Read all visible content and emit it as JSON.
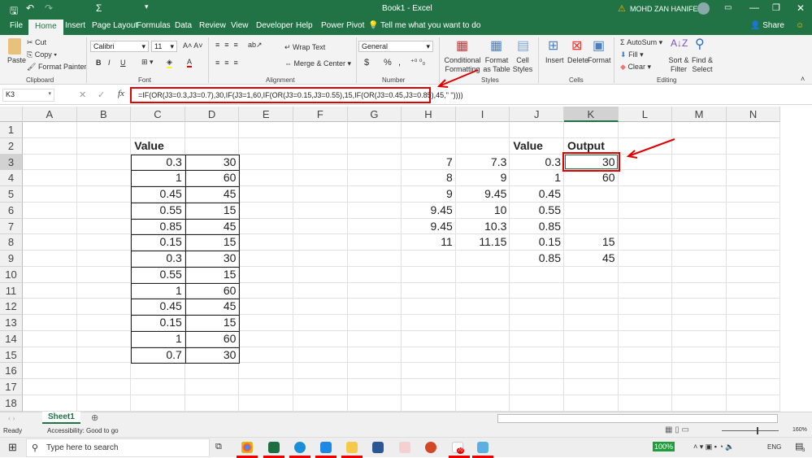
{
  "title": {
    "doc": "Book1 - Excel",
    "user": "MOHD ZAN HANIFEE"
  },
  "tabs": [
    "File",
    "Home",
    "Insert",
    "Page Layout",
    "Formulas",
    "Data",
    "Review",
    "View",
    "Developer",
    "Help",
    "Power Pivot"
  ],
  "tell_me": "Tell me what you want to do",
  "share": "Share",
  "ribbon": {
    "paste": "Paste",
    "cut": "Cut",
    "copy": "Copy",
    "format_painter": "Format Painter",
    "clipboard": "Clipboard",
    "font_name": "Calibri",
    "font_size": "11",
    "font": "Font",
    "bold": "B",
    "italic": "I",
    "underline": "U",
    "wrap_text": "Wrap Text",
    "merge_center": "Merge & Center",
    "alignment": "Alignment",
    "number_format": "General",
    "currency": "$",
    "percent": "%",
    "comma": ",",
    "number": "Number",
    "conditional_formatting": "Conditional Formatting",
    "format_as_table": "Format as Table",
    "cell_styles": "Cell Styles",
    "styles": "Styles",
    "insert": "Insert",
    "delete": "Delete",
    "format": "Format",
    "cells": "Cells",
    "autosum": "AutoSum",
    "fill": "Fill",
    "clear": "Clear",
    "sort_filter": "Sort & Filter",
    "find_select": "Find & Select",
    "editing": "Editing"
  },
  "formula_bar": {
    "name_box": "K3",
    "fx": "fx",
    "formula": "=IF(OR(J3=0.3,J3=0.7),30,IF(J3=1,60,IF(OR(J3=0.15,J3=0.55),15,IF(OR(J3=0.45,J3=0.85),45,\" \"))))"
  },
  "columns": [
    "A",
    "B",
    "C",
    "D",
    "E",
    "F",
    "G",
    "H",
    "I",
    "J",
    "K",
    "L",
    "M",
    "N"
  ],
  "rows": [
    "1",
    "2",
    "3",
    "4",
    "5",
    "6",
    "7",
    "8",
    "9",
    "10",
    "11",
    "12",
    "13",
    "14",
    "15",
    "16",
    "17",
    "18"
  ],
  "cells": [
    {
      "c": 2,
      "r": 2,
      "v": "Value",
      "b": true
    },
    {
      "c": 2,
      "r": 3,
      "v": "0.3"
    },
    {
      "c": 3,
      "r": 3,
      "v": "30"
    },
    {
      "c": 2,
      "r": 4,
      "v": "1"
    },
    {
      "c": 3,
      "r": 4,
      "v": "60"
    },
    {
      "c": 2,
      "r": 5,
      "v": "0.45"
    },
    {
      "c": 3,
      "r": 5,
      "v": "45"
    },
    {
      "c": 2,
      "r": 6,
      "v": "0.55"
    },
    {
      "c": 3,
      "r": 6,
      "v": "15"
    },
    {
      "c": 2,
      "r": 7,
      "v": "0.85"
    },
    {
      "c": 3,
      "r": 7,
      "v": "45"
    },
    {
      "c": 2,
      "r": 8,
      "v": "0.15"
    },
    {
      "c": 3,
      "r": 8,
      "v": "15"
    },
    {
      "c": 2,
      "r": 9,
      "v": "0.3"
    },
    {
      "c": 3,
      "r": 9,
      "v": "30"
    },
    {
      "c": 2,
      "r": 10,
      "v": "0.55"
    },
    {
      "c": 3,
      "r": 10,
      "v": "15"
    },
    {
      "c": 2,
      "r": 11,
      "v": "1"
    },
    {
      "c": 3,
      "r": 11,
      "v": "60"
    },
    {
      "c": 2,
      "r": 12,
      "v": "0.45"
    },
    {
      "c": 3,
      "r": 12,
      "v": "45"
    },
    {
      "c": 2,
      "r": 13,
      "v": "0.15"
    },
    {
      "c": 3,
      "r": 13,
      "v": "15"
    },
    {
      "c": 2,
      "r": 14,
      "v": "1"
    },
    {
      "c": 3,
      "r": 14,
      "v": "60"
    },
    {
      "c": 2,
      "r": 15,
      "v": "0.7"
    },
    {
      "c": 3,
      "r": 15,
      "v": "30"
    },
    {
      "c": 9,
      "r": 2,
      "v": "Value",
      "b": true
    },
    {
      "c": 10,
      "r": 2,
      "v": "Output",
      "b": true
    },
    {
      "c": 7,
      "r": 3,
      "v": "7"
    },
    {
      "c": 8,
      "r": 3,
      "v": "7.3"
    },
    {
      "c": 9,
      "r": 3,
      "v": "0.3"
    },
    {
      "c": 10,
      "r": 3,
      "v": "30"
    },
    {
      "c": 7,
      "r": 4,
      "v": "8"
    },
    {
      "c": 8,
      "r": 4,
      "v": "9"
    },
    {
      "c": 9,
      "r": 4,
      "v": "1"
    },
    {
      "c": 10,
      "r": 4,
      "v": "60"
    },
    {
      "c": 7,
      "r": 5,
      "v": "9"
    },
    {
      "c": 8,
      "r": 5,
      "v": "9.45"
    },
    {
      "c": 9,
      "r": 5,
      "v": "0.45"
    },
    {
      "c": 7,
      "r": 6,
      "v": "9.45"
    },
    {
      "c": 8,
      "r": 6,
      "v": "10"
    },
    {
      "c": 9,
      "r": 6,
      "v": "0.55"
    },
    {
      "c": 7,
      "r": 7,
      "v": "9.45"
    },
    {
      "c": 8,
      "r": 7,
      "v": "10.3"
    },
    {
      "c": 9,
      "r": 7,
      "v": "0.85"
    },
    {
      "c": 7,
      "r": 8,
      "v": "11"
    },
    {
      "c": 8,
      "r": 8,
      "v": "11.15"
    },
    {
      "c": 9,
      "r": 8,
      "v": "0.15"
    },
    {
      "c": 10,
      "r": 8,
      "v": "15"
    },
    {
      "c": 9,
      "r": 9,
      "v": "0.85"
    },
    {
      "c": 10,
      "r": 9,
      "v": "45"
    }
  ],
  "sheet_tab": "Sheet1",
  "status": {
    "ready": "Ready",
    "accessibility": "Accessibility: Good to go",
    "zoom": "160%"
  },
  "taskbar": {
    "search": "Type here to search",
    "battery": "100%",
    "lang": "ENG",
    "notif": "3",
    "badge": "70"
  },
  "accent": "#217346",
  "highlight": "#e00000"
}
